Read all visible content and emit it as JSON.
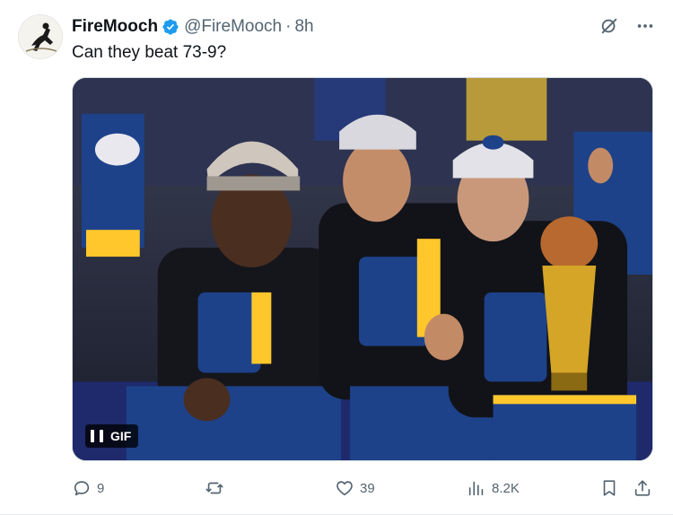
{
  "tweet": {
    "author_name": "FireMooch",
    "handle": "@FireMooch",
    "separator": "·",
    "time": "8h",
    "text": "Can they beat 73-9?",
    "media": {
      "badge_label": "GIF",
      "description_icon": "pause-icon"
    },
    "stats": {
      "replies": "9",
      "retweets": "",
      "likes": "39",
      "views": "8.2K"
    }
  },
  "colors": {
    "verified": "#1d9bf0",
    "text_primary": "#0f1419",
    "text_secondary": "#536471",
    "warriors_blue": "#1d428a",
    "warriors_gold": "#ffc72c"
  },
  "icons": {
    "verified": "verified-badge-icon",
    "grok": "grok-icon",
    "more": "more-icon",
    "reply": "reply-icon",
    "retweet": "retweet-icon",
    "like": "heart-icon",
    "views": "views-icon",
    "bookmark": "bookmark-icon",
    "share": "share-icon"
  }
}
